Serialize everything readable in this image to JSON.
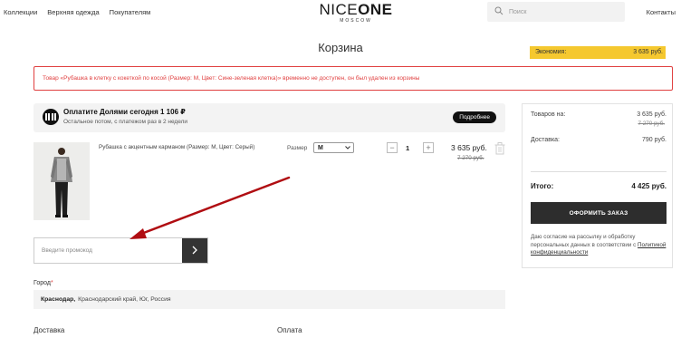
{
  "nav": {
    "items": [
      {
        "label": "Коллекции"
      },
      {
        "label": "Верхняя одежда"
      },
      {
        "label": "Покупателям"
      }
    ],
    "contacts": "Контакты"
  },
  "logo": {
    "part1": "NICE",
    "part2": "ONE",
    "sub": "MOSCOW"
  },
  "search": {
    "placeholder": "Поиск",
    "icon": "search-icon"
  },
  "page_title": "Корзина",
  "alert": {
    "text": "Товар «Рубашка в клетку с кокеткой по косой (Размер: M, Цвет: Сине-зеленая клетка)» временно не доступен, он был удален из корзины",
    "color": "#e04040"
  },
  "dolyami": {
    "title": "Оплатите Долями сегодня 1 106 ₽",
    "subtitle": "Остальное потом, с платежом раз в 2 недели",
    "more_label": "Подробнее"
  },
  "cart": {
    "item": {
      "name": "Рубашка с акцентным карманом (Размер: M, Цвет: Серый)",
      "size_label": "Размер",
      "size_value": "M",
      "quantity": "1",
      "minus": "−",
      "plus": "+",
      "price": "3 635 руб.",
      "old_price": "7 270 руб."
    }
  },
  "promo": {
    "placeholder": "Введите промокод"
  },
  "city": {
    "label": "Город",
    "required_mark": "*",
    "city_name": "Краснодар,",
    "region": "Краснодарский край, Юг, Россия"
  },
  "sections": {
    "delivery": "Доставка",
    "payment": "Оплата"
  },
  "summary": {
    "goods_label": "Товаров на:",
    "goods_value": "3 635 руб.",
    "goods_old": "7 270 руб.",
    "delivery_label": "Доставка:",
    "delivery_value": "790 руб.",
    "economy_label": "Экономия:",
    "economy_value": "3 635 руб.",
    "total_label": "Итого:",
    "total_value": "4 425 руб.",
    "order_button": "ОФОРМИТЬ ЗАКАЗ",
    "consent_text": "Даю согласие на рассылку и обработку персональных данных в соответствии с",
    "policy_link": "Политикой конфиденциальности",
    "economy_color": "#f5c82f"
  },
  "annotation": {
    "arrow_color": "#b00d12"
  }
}
